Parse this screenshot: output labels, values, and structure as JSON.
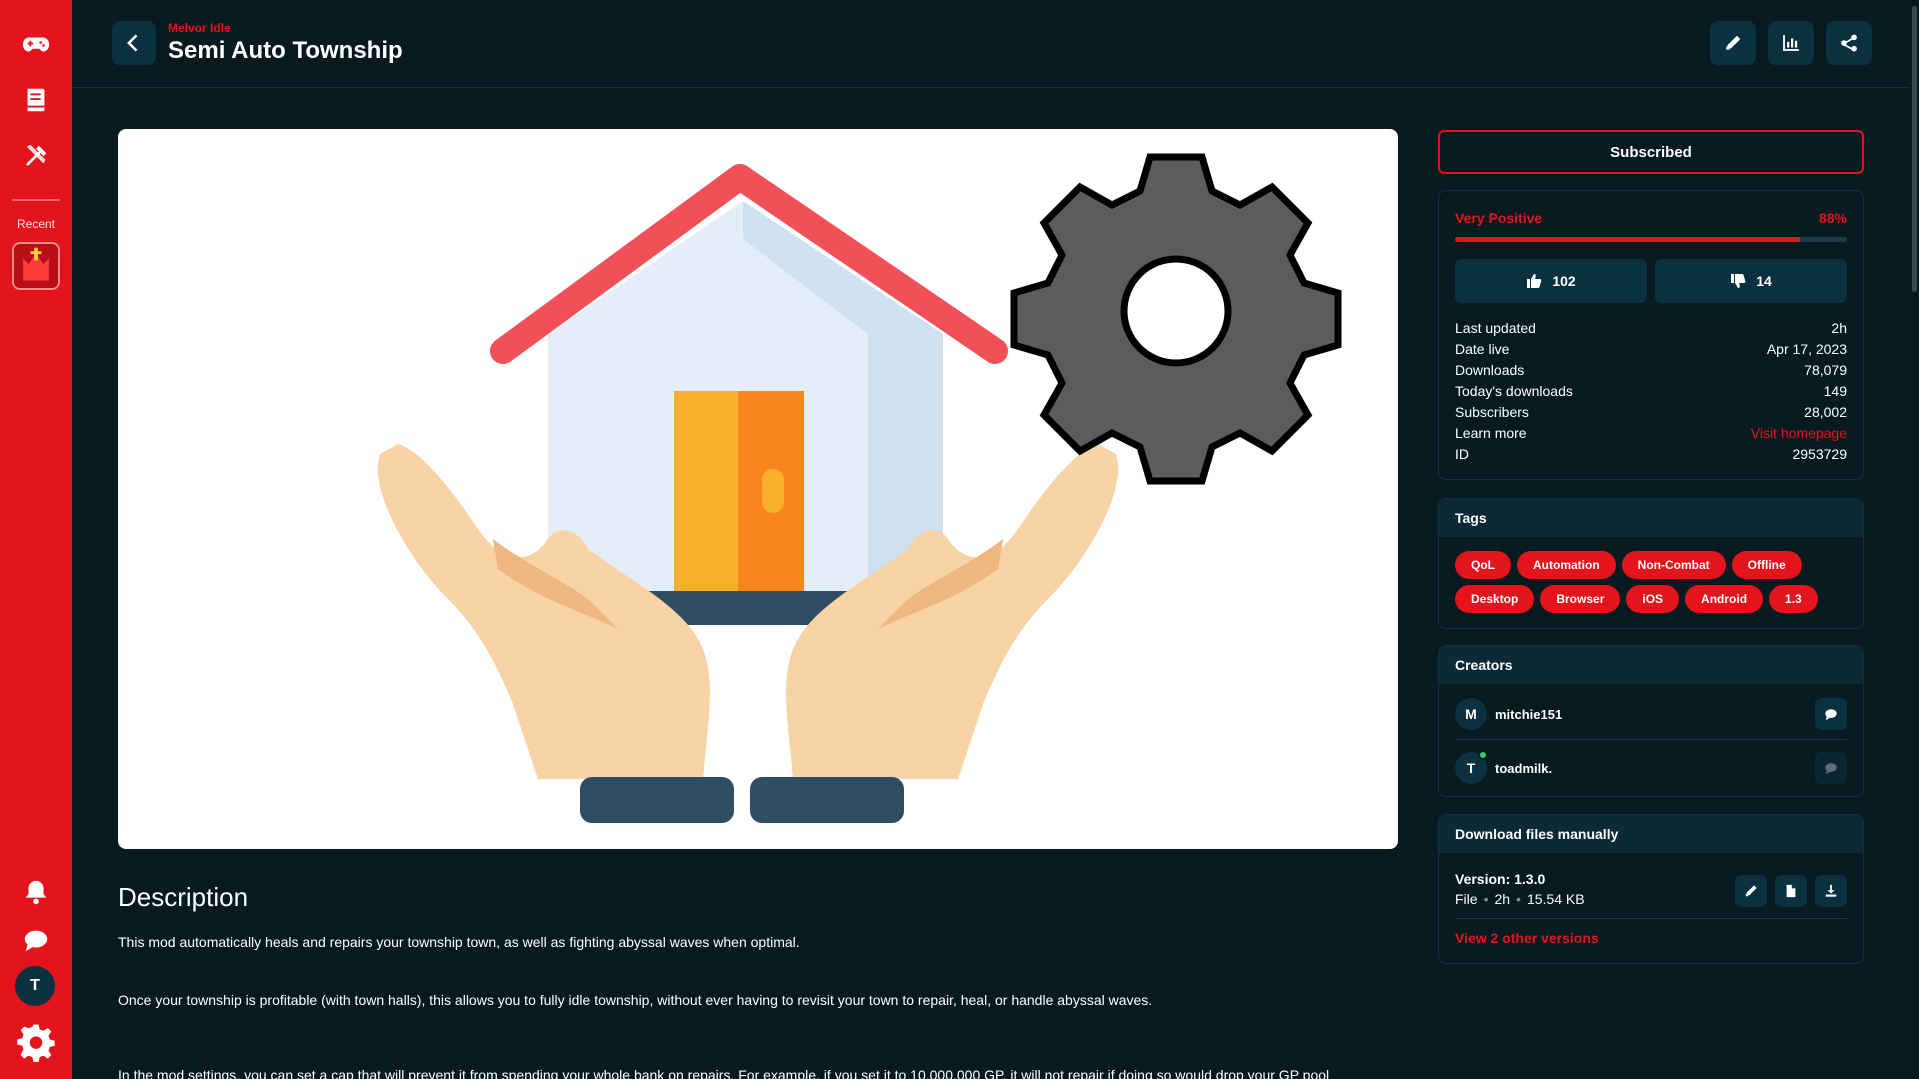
{
  "colors": {
    "accent": "#e3141c",
    "background": "#061a20",
    "panel": "#0b3140",
    "online": "#2ed06e"
  },
  "sidebar": {
    "icons": [
      "gamepad-icon",
      "book-icon",
      "tools-icon",
      "bell-icon",
      "chat-icon",
      "settings-icon"
    ],
    "recent_label": "Recent",
    "user_initial": "T"
  },
  "header": {
    "game": "Melvor Idle",
    "title": "Semi Auto Township",
    "actions": [
      "edit-icon",
      "stats-icon",
      "share-icon"
    ]
  },
  "description": {
    "heading": "Description",
    "paragraphs": [
      "This mod automatically heals and repairs your township town, as well as fighting abyssal waves when optimal.",
      "Once your township is profitable (with town halls), this allows you to fully idle township, without ever having to revisit your town to repair, heal, or handle abyssal waves.",
      "In the mod settings, you can set a cap that will prevent it from spending your whole bank on repairs. For example, if you set it to 10,000,000 GP, it will not repair if doing so would drop your GP pool"
    ]
  },
  "subscribe": {
    "label": "Subscribed"
  },
  "rating": {
    "label": "Very Positive",
    "percent_text": "88%",
    "percent": 88,
    "upvotes": "102",
    "downvotes": "14"
  },
  "stats": [
    {
      "label": "Last updated",
      "value": "2h"
    },
    {
      "label": "Date live",
      "value": "Apr 17, 2023"
    },
    {
      "label": "Downloads",
      "value": "78,079"
    },
    {
      "label": "Today's downloads",
      "value": "149"
    },
    {
      "label": "Subscribers",
      "value": "28,002"
    },
    {
      "label": "Learn more",
      "value": "Visit homepage"
    },
    {
      "label": "ID",
      "value": "2953729"
    }
  ],
  "tags": {
    "heading": "Tags",
    "items": [
      "QoL",
      "Automation",
      "Non-Combat",
      "Offline",
      "Desktop",
      "Browser",
      "iOS",
      "Android",
      "1.3"
    ]
  },
  "creators": {
    "heading": "Creators",
    "items": [
      {
        "initial": "M",
        "name": "mitchie151",
        "online": false
      },
      {
        "initial": "T",
        "name": "toadmilk.",
        "online": true
      }
    ]
  },
  "download": {
    "heading": "Download files manually",
    "version": "Version: 1.3.0",
    "file_type": "File",
    "age": "2h",
    "size": "15.54 KB",
    "other_versions": "View 2 other versions"
  }
}
